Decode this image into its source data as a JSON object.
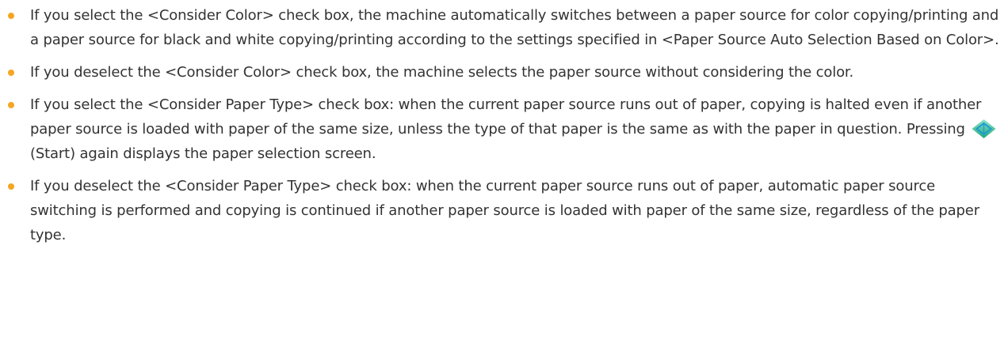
{
  "notes": [
    {
      "text": "If you select the <Consider Color> check box, the machine automatically switches between a paper source for color copying/printing and a paper source for black and white copying/printing according to the settings specified in <Paper Source Auto Selection Based on Color>."
    },
    {
      "text": "If you deselect the <Consider Color> check box, the machine selects the paper source without considering the color."
    },
    {
      "text_before_icon": "If you select the <Consider Paper Type> check box: when the current paper source runs out of paper, copying is halted even if another paper source is loaded with paper of the same size, unless the type of that paper is the same as with the paper in question. Pressing",
      "icon": "start-key-icon",
      "text_after_icon": "(Start) again displays the paper selection screen."
    },
    {
      "text": "If you deselect the <Consider Paper Type> check box: when the current paper source runs out of paper, automatic paper source switching is performed and copying is continued if another paper source is loaded with paper of the same size, regardless of the paper type."
    }
  ],
  "colors": {
    "text": "#333333",
    "bullet": "#f5a623",
    "start_icon_gradient_top": "#8fe3c6",
    "start_icon_gradient_bottom": "#1fa97a",
    "start_icon_outline": "#1d9bd6"
  }
}
